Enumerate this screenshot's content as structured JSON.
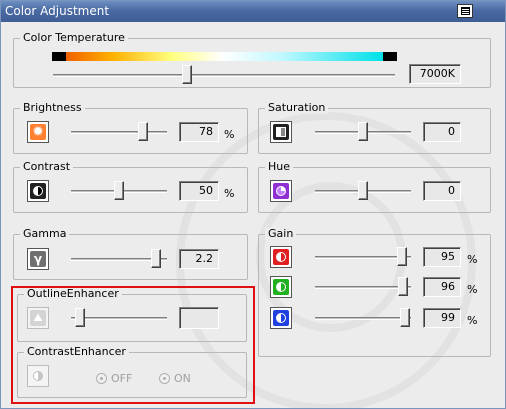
{
  "window": {
    "title": "Color Adjustment"
  },
  "color_temperature": {
    "title": "Color Temperature",
    "value": "7000K",
    "slider_level": 0.39
  },
  "brightness": {
    "title": "Brightness",
    "value": "78",
    "unit": "%",
    "slider_level": 0.78
  },
  "contrast": {
    "title": "Contrast",
    "value": "50",
    "unit": "%",
    "slider_level": 0.5
  },
  "gamma": {
    "title": "Gamma",
    "value": "2.2",
    "slider_level": 0.93
  },
  "outline_enhancer": {
    "title": "OutlineEnhancer",
    "value": "",
    "slider_level": 0.05,
    "enabled": false
  },
  "contrast_enhancer": {
    "title": "ContrastEnhancer",
    "off_label": "OFF",
    "on_label": "ON",
    "selected": "none",
    "enabled": false
  },
  "saturation": {
    "title": "Saturation",
    "value": "0",
    "slider_level": 0.5
  },
  "hue": {
    "title": "Hue",
    "value": "0",
    "slider_level": 0.5
  },
  "gain": {
    "title": "Gain",
    "channels": [
      {
        "name": "red",
        "value": "95",
        "unit": "%",
        "slider_level": 0.95,
        "color": "#e02020"
      },
      {
        "name": "green",
        "value": "96",
        "unit": "%",
        "slider_level": 0.96,
        "color": "#20b020"
      },
      {
        "name": "blue",
        "value": "99",
        "unit": "%",
        "slider_level": 0.99,
        "color": "#2040e0"
      }
    ]
  },
  "colors": {
    "titlebar": "#4a6aa3",
    "highlight": "#e01010",
    "brightness_icon": "#ff8030",
    "hue_icon": "#9030d0"
  }
}
